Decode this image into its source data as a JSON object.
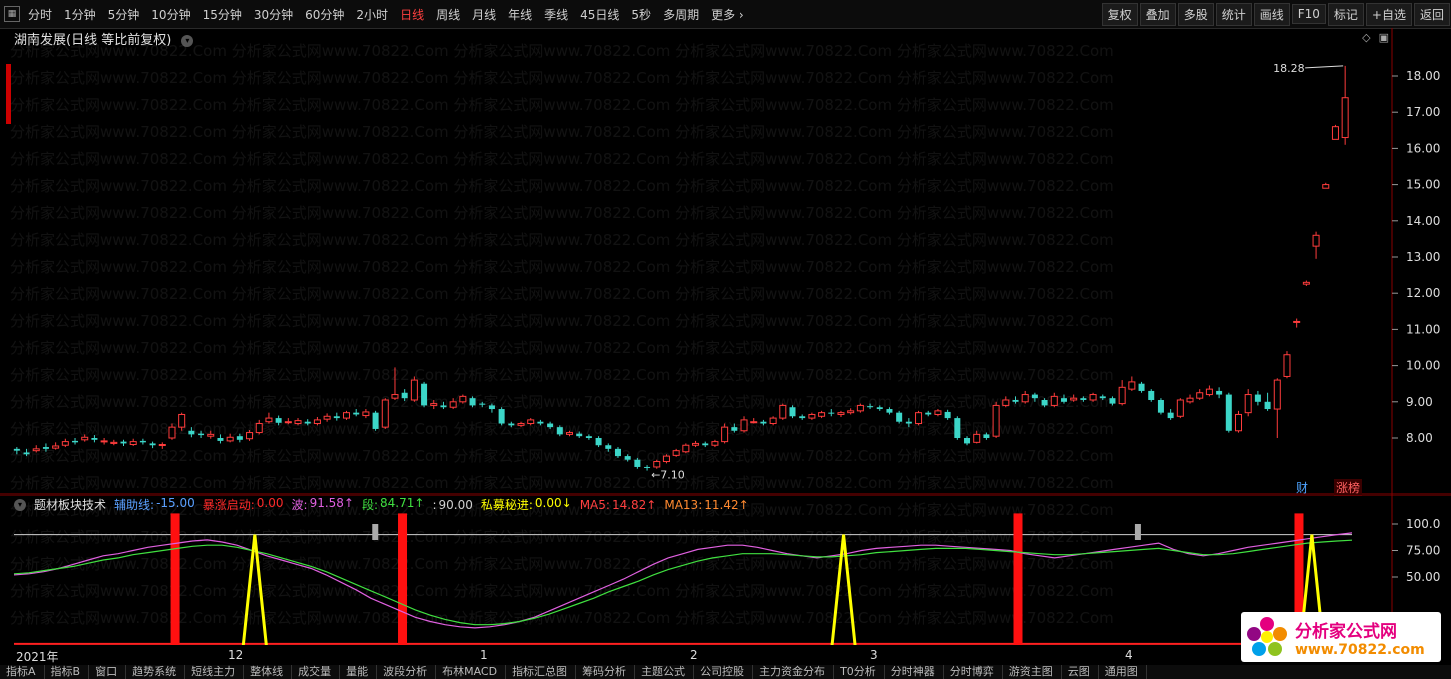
{
  "toolbar": {
    "periods": [
      "分时",
      "1分钟",
      "5分钟",
      "10分钟",
      "15分钟",
      "30分钟",
      "60分钟",
      "2小时",
      "日线",
      "周线",
      "月线",
      "年线",
      "季线",
      "45日线",
      "5秒",
      "多周期",
      "更多"
    ],
    "active_period": "日线",
    "right_buttons": [
      "复权",
      "叠加",
      "多股",
      "统计",
      "画线",
      "F10",
      "标记",
      "+自选",
      "返回"
    ]
  },
  "stock": {
    "title": "湖南发展(日线 等比前复权)",
    "high_label": "18.28",
    "low_label": "7.10"
  },
  "price_axis": [
    "18.00",
    "17.00",
    "16.00",
    "15.00",
    "14.00",
    "13.00",
    "12.00",
    "11.00",
    "10.00",
    "9.00",
    "8.00"
  ],
  "badges": {
    "cai": "财",
    "zhang": "涨榜"
  },
  "indicator": {
    "name": "题材板块技术",
    "items": [
      {
        "label": "辅助线:",
        "value": "-15.00",
        "color": "#5aa0ff"
      },
      {
        "label": "暴涨启动:",
        "value": "0.00",
        "color": "#ff2a2a"
      },
      {
        "label": "波:",
        "value": "91.58↑",
        "color": "#e060e0"
      },
      {
        "label": "段:",
        "value": "84.71↑",
        "color": "#40e040"
      },
      {
        "label": ":",
        "value": "90.00",
        "color": "#d0d0d0"
      },
      {
        "label": "私募秘进:",
        "value": "0.00↓",
        "color": "#ffff00"
      },
      {
        "label": "MA5:",
        "value": "14.82↑",
        "color": "#ff4040"
      },
      {
        "label": "MA13:",
        "value": "11.42↑",
        "color": "#ff8a30"
      }
    ],
    "axis": [
      "100.0",
      "75.00",
      "50.00"
    ]
  },
  "date_axis": [
    "2021年",
    "12",
    "1",
    "2",
    "3",
    "4"
  ],
  "bottom_tabs": [
    "指标A",
    "指标B",
    "窗口",
    "趋势系统",
    "短线主力",
    "整体线",
    "成交量",
    "量能",
    "波段分析",
    "布林MACD",
    "指标汇总图",
    "筹码分析",
    "主题公式",
    "公司控股",
    "主力资金分布",
    "T0分析",
    "分时神器",
    "分时博弈",
    "游资主图",
    "云图",
    "通用图"
  ],
  "watermark": {
    "text": "分析家公式网www.70822.Com",
    "logo_title": "分析家公式网",
    "logo_url": "www.70822.com"
  },
  "chart_data": [
    {
      "type": "candlestick",
      "title": "湖南发展(日线 等比前复权)",
      "ylim": [
        7.0,
        18.5
      ],
      "annotations": {
        "max": 18.28,
        "min": 7.1
      },
      "candles": [
        [
          7.7,
          7.65,
          7.75,
          7.55
        ],
        [
          7.6,
          7.55,
          7.7,
          7.5
        ],
        [
          7.65,
          7.7,
          7.8,
          7.6
        ],
        [
          7.75,
          7.7,
          7.85,
          7.62
        ],
        [
          7.72,
          7.78,
          7.88,
          7.68
        ],
        [
          7.8,
          7.9,
          7.98,
          7.75
        ],
        [
          7.92,
          7.88,
          8.0,
          7.82
        ],
        [
          7.95,
          8.02,
          8.1,
          7.9
        ],
        [
          8.0,
          7.95,
          8.08,
          7.88
        ],
        [
          7.9,
          7.92,
          8.0,
          7.82
        ],
        [
          7.85,
          7.88,
          7.95,
          7.8
        ],
        [
          7.9,
          7.85,
          7.95,
          7.78
        ],
        [
          7.82,
          7.9,
          7.98,
          7.78
        ],
        [
          7.92,
          7.88,
          7.98,
          7.82
        ],
        [
          7.85,
          7.8,
          7.9,
          7.72
        ],
        [
          7.8,
          7.82,
          7.88,
          7.7
        ],
        [
          8.0,
          8.3,
          8.4,
          7.95
        ],
        [
          8.3,
          8.65,
          8.7,
          8.2
        ],
        [
          8.2,
          8.1,
          8.3,
          8.02
        ],
        [
          8.12,
          8.08,
          8.2,
          8.0
        ],
        [
          8.05,
          8.1,
          8.2,
          7.98
        ],
        [
          8.0,
          7.92,
          8.1,
          7.85
        ],
        [
          7.92,
          8.02,
          8.12,
          7.88
        ],
        [
          8.05,
          7.95,
          8.12,
          7.88
        ],
        [
          7.98,
          8.15,
          8.22,
          7.92
        ],
        [
          8.15,
          8.4,
          8.5,
          8.1
        ],
        [
          8.45,
          8.55,
          8.7,
          8.4
        ],
        [
          8.55,
          8.42,
          8.62,
          8.35
        ],
        [
          8.45,
          8.45,
          8.55,
          8.38
        ],
        [
          8.4,
          8.48,
          8.55,
          8.35
        ],
        [
          8.45,
          8.4,
          8.52,
          8.35
        ],
        [
          8.4,
          8.5,
          8.58,
          8.35
        ],
        [
          8.52,
          8.6,
          8.68,
          8.45
        ],
        [
          8.6,
          8.55,
          8.7,
          8.48
        ],
        [
          8.55,
          8.7,
          8.75,
          8.5
        ],
        [
          8.7,
          8.65,
          8.8,
          8.6
        ],
        [
          8.62,
          8.72,
          8.8,
          8.55
        ],
        [
          8.7,
          8.25,
          8.75,
          8.2
        ],
        [
          8.3,
          9.05,
          9.1,
          8.25
        ],
        [
          9.1,
          9.2,
          9.95,
          9.05
        ],
        [
          9.25,
          9.1,
          9.35,
          9.02
        ],
        [
          9.05,
          9.6,
          9.7,
          9.0
        ],
        [
          9.5,
          8.9,
          9.55,
          8.85
        ],
        [
          8.9,
          8.95,
          9.05,
          8.8
        ],
        [
          8.9,
          8.85,
          9.0,
          8.8
        ],
        [
          8.85,
          9.0,
          9.1,
          8.8
        ],
        [
          9.0,
          9.15,
          9.2,
          8.95
        ],
        [
          9.1,
          8.9,
          9.15,
          8.85
        ],
        [
          8.95,
          8.92,
          9.0,
          8.85
        ],
        [
          8.9,
          8.8,
          8.95,
          8.7
        ],
        [
          8.8,
          8.4,
          8.85,
          8.35
        ],
        [
          8.4,
          8.35,
          8.45,
          8.3
        ],
        [
          8.35,
          8.4,
          8.45,
          8.3
        ],
        [
          8.4,
          8.5,
          8.55,
          8.35
        ],
        [
          8.45,
          8.4,
          8.5,
          8.35
        ],
        [
          8.4,
          8.3,
          8.45,
          8.25
        ],
        [
          8.3,
          8.1,
          8.35,
          8.05
        ],
        [
          8.1,
          8.15,
          8.2,
          8.05
        ],
        [
          8.12,
          8.05,
          8.18,
          8.0
        ],
        [
          8.05,
          8.0,
          8.1,
          7.95
        ],
        [
          8.0,
          7.8,
          8.05,
          7.75
        ],
        [
          7.8,
          7.7,
          7.85,
          7.62
        ],
        [
          7.7,
          7.5,
          7.75,
          7.45
        ],
        [
          7.5,
          7.4,
          7.55,
          7.35
        ],
        [
          7.4,
          7.2,
          7.45,
          7.15
        ],
        [
          7.2,
          7.18,
          7.25,
          7.1
        ],
        [
          7.2,
          7.35,
          7.4,
          7.15
        ],
        [
          7.35,
          7.5,
          7.55,
          7.3
        ],
        [
          7.52,
          7.65,
          7.7,
          7.48
        ],
        [
          7.62,
          7.8,
          7.85,
          7.58
        ],
        [
          7.8,
          7.85,
          7.92,
          7.75
        ],
        [
          7.85,
          7.8,
          7.9,
          7.75
        ],
        [
          7.8,
          7.9,
          7.95,
          7.75
        ],
        [
          7.9,
          8.3,
          8.4,
          7.85
        ],
        [
          8.3,
          8.2,
          8.4,
          8.15
        ],
        [
          8.2,
          8.5,
          8.6,
          8.15
        ],
        [
          8.45,
          8.45,
          8.55,
          8.4
        ],
        [
          8.45,
          8.4,
          8.5,
          8.35
        ],
        [
          8.4,
          8.55,
          8.6,
          8.35
        ],
        [
          8.55,
          8.9,
          8.95,
          8.5
        ],
        [
          8.85,
          8.6,
          8.9,
          8.55
        ],
        [
          8.6,
          8.55,
          8.65,
          8.5
        ],
        [
          8.55,
          8.65,
          8.7,
          8.5
        ],
        [
          8.6,
          8.7,
          8.75,
          8.55
        ],
        [
          8.7,
          8.68,
          8.8,
          8.6
        ],
        [
          8.65,
          8.7,
          8.75,
          8.58
        ],
        [
          8.7,
          8.75,
          8.82,
          8.65
        ],
        [
          8.75,
          8.9,
          8.95,
          8.7
        ],
        [
          8.88,
          8.85,
          8.95,
          8.8
        ],
        [
          8.85,
          8.8,
          8.9,
          8.75
        ],
        [
          8.8,
          8.7,
          8.85,
          8.65
        ],
        [
          8.7,
          8.45,
          8.75,
          8.4
        ],
        [
          8.45,
          8.4,
          8.55,
          8.3
        ],
        [
          8.4,
          8.7,
          8.75,
          8.35
        ],
        [
          8.7,
          8.65,
          8.75,
          8.6
        ],
        [
          8.65,
          8.75,
          8.8,
          8.6
        ],
        [
          8.72,
          8.55,
          8.78,
          8.5
        ],
        [
          8.55,
          8.0,
          8.6,
          7.95
        ],
        [
          8.0,
          7.85,
          8.05,
          7.8
        ],
        [
          7.88,
          8.1,
          8.2,
          7.85
        ],
        [
          8.1,
          8.0,
          8.15,
          7.95
        ],
        [
          8.05,
          8.9,
          9.0,
          8.0
        ],
        [
          8.9,
          9.05,
          9.15,
          8.85
        ],
        [
          9.05,
          9.0,
          9.15,
          8.95
        ],
        [
          9.0,
          9.2,
          9.3,
          8.95
        ],
        [
          9.2,
          9.1,
          9.25,
          9.0
        ],
        [
          9.05,
          8.9,
          9.1,
          8.85
        ],
        [
          8.9,
          9.15,
          9.25,
          8.85
        ],
        [
          9.1,
          9.0,
          9.2,
          8.95
        ],
        [
          9.05,
          9.1,
          9.2,
          9.0
        ],
        [
          9.1,
          9.05,
          9.15,
          9.0
        ],
        [
          9.05,
          9.2,
          9.25,
          9.0
        ],
        [
          9.15,
          9.1,
          9.2,
          9.05
        ],
        [
          9.1,
          8.95,
          9.15,
          8.9
        ],
        [
          8.95,
          9.4,
          9.6,
          8.9
        ],
        [
          9.35,
          9.55,
          9.7,
          9.3
        ],
        [
          9.5,
          9.3,
          9.55,
          9.25
        ],
        [
          9.3,
          9.05,
          9.35,
          9.0
        ],
        [
          9.05,
          8.7,
          9.1,
          8.65
        ],
        [
          8.7,
          8.55,
          8.8,
          8.5
        ],
        [
          8.6,
          9.05,
          9.1,
          8.55
        ],
        [
          9.0,
          9.1,
          9.2,
          8.95
        ],
        [
          9.1,
          9.25,
          9.35,
          9.05
        ],
        [
          9.2,
          9.35,
          9.45,
          9.15
        ],
        [
          9.3,
          9.2,
          9.4,
          9.1
        ],
        [
          9.2,
          8.2,
          9.25,
          8.15
        ],
        [
          8.2,
          8.65,
          8.75,
          8.15
        ],
        [
          8.7,
          9.2,
          9.35,
          8.6
        ],
        [
          9.2,
          9.0,
          9.3,
          8.9
        ],
        [
          9.0,
          8.8,
          9.25,
          8.75
        ],
        [
          8.8,
          9.6,
          9.65,
          8.0
        ],
        [
          9.7,
          10.3,
          10.4,
          9.65
        ],
        [
          11.2,
          11.22,
          11.3,
          11.05
        ],
        [
          12.25,
          12.3,
          12.35,
          12.2
        ],
        [
          13.3,
          13.6,
          13.7,
          12.95
        ],
        [
          14.9,
          15.0,
          15.05,
          14.95
        ],
        [
          16.25,
          16.6,
          16.65,
          16.25
        ],
        [
          16.3,
          17.4,
          18.28,
          16.1
        ]
      ]
    },
    {
      "type": "line",
      "title": "题材板块技术",
      "ylim": [
        -20,
        110
      ],
      "series": [
        {
          "name": "波",
          "color": "#e060e0",
          "values": [
            52,
            53,
            55,
            58,
            62,
            66,
            70,
            72,
            75,
            78,
            80,
            82,
            84,
            85,
            83,
            80,
            75,
            70,
            66,
            62,
            58,
            52,
            45,
            38,
            30,
            24,
            18,
            12,
            8,
            5,
            3,
            2,
            3,
            5,
            8,
            12,
            18,
            24,
            30,
            36,
            42,
            48,
            55,
            62,
            68,
            72,
            76,
            78,
            80,
            80,
            78,
            75,
            72,
            70,
            68,
            70,
            72,
            75,
            77,
            78,
            79,
            80,
            80,
            79,
            78,
            77,
            76,
            75,
            72,
            70,
            68,
            70,
            72,
            74,
            76,
            78,
            80,
            82,
            76,
            72,
            70,
            72,
            75,
            78,
            80,
            82,
            84,
            86,
            88,
            90,
            91.58
          ]
        },
        {
          "name": "段",
          "color": "#40e040",
          "values": [
            53,
            54,
            56,
            58,
            60,
            63,
            66,
            68,
            71,
            73,
            75,
            77,
            79,
            80,
            80,
            78,
            75,
            72,
            68,
            64,
            60,
            55,
            49,
            43,
            37,
            31,
            25,
            19,
            14,
            10,
            7,
            5,
            5,
            6,
            8,
            11,
            15,
            20,
            25,
            30,
            36,
            41,
            46,
            52,
            57,
            61,
            65,
            68,
            70,
            72,
            72,
            72,
            71,
            70,
            69,
            69,
            70,
            71,
            73,
            74,
            75,
            76,
            77,
            77,
            77,
            76,
            75,
            74,
            73,
            72,
            71,
            71,
            72,
            73,
            74,
            75,
            76,
            77,
            75,
            73,
            71,
            71,
            72,
            74,
            76,
            78,
            80,
            82,
            83,
            84,
            84.71
          ]
        },
        {
          "name": "私募秘进",
          "color": "#ffff00",
          "spikes_at": [
            0.18,
            0.62,
            0.97
          ],
          "value": 0.0
        },
        {
          "name": "辅助线",
          "color": "#5aa0ff",
          "value": -15.0
        }
      ],
      "reference_line": 90.0
    }
  ]
}
